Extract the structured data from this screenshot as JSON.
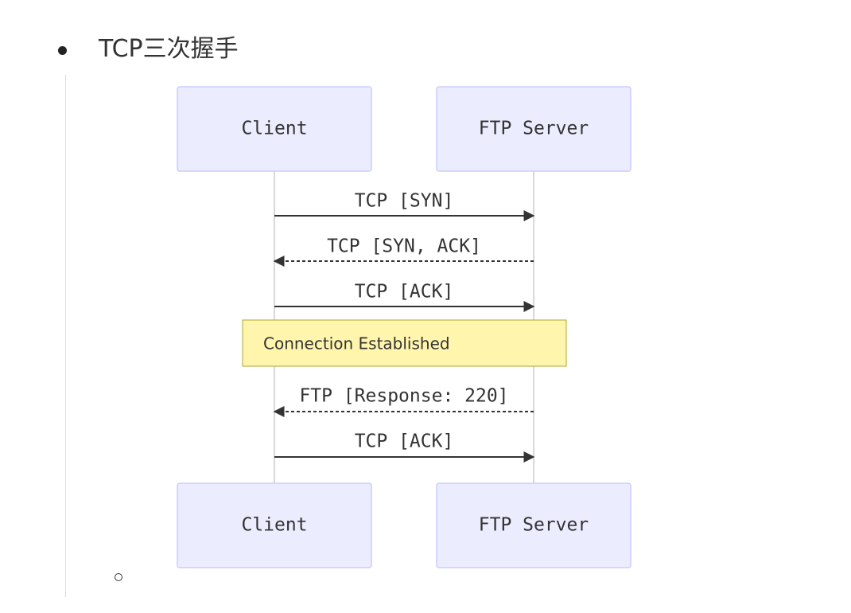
{
  "heading": "TCP三次握手",
  "diagram": {
    "participants": [
      {
        "id": "client",
        "label": "Client"
      },
      {
        "id": "server",
        "label": "FTP Server"
      }
    ],
    "messages": [
      {
        "label": "TCP [SYN]",
        "from": "client",
        "to": "server",
        "line": "solid"
      },
      {
        "label": "TCP [SYN, ACK]",
        "from": "server",
        "to": "client",
        "line": "dashed"
      },
      {
        "label": "TCP [ACK]",
        "from": "client",
        "to": "server",
        "line": "solid"
      },
      {
        "label": "FTP [Response: 220]",
        "from": "server",
        "to": "client",
        "line": "dashed"
      },
      {
        "label": "TCP [ACK]",
        "from": "client",
        "to": "server",
        "line": "solid"
      }
    ],
    "note": {
      "text": "Connection Established",
      "after_message": 3,
      "over": [
        "client",
        "server"
      ]
    },
    "colors": {
      "actor_fill": "#ECECFF",
      "actor_stroke": "#CCCCFF",
      "note_fill": "#FFF5AD",
      "note_stroke": "#AAAA33",
      "lifeline": "#cccccc",
      "arrow": "#333333"
    }
  }
}
